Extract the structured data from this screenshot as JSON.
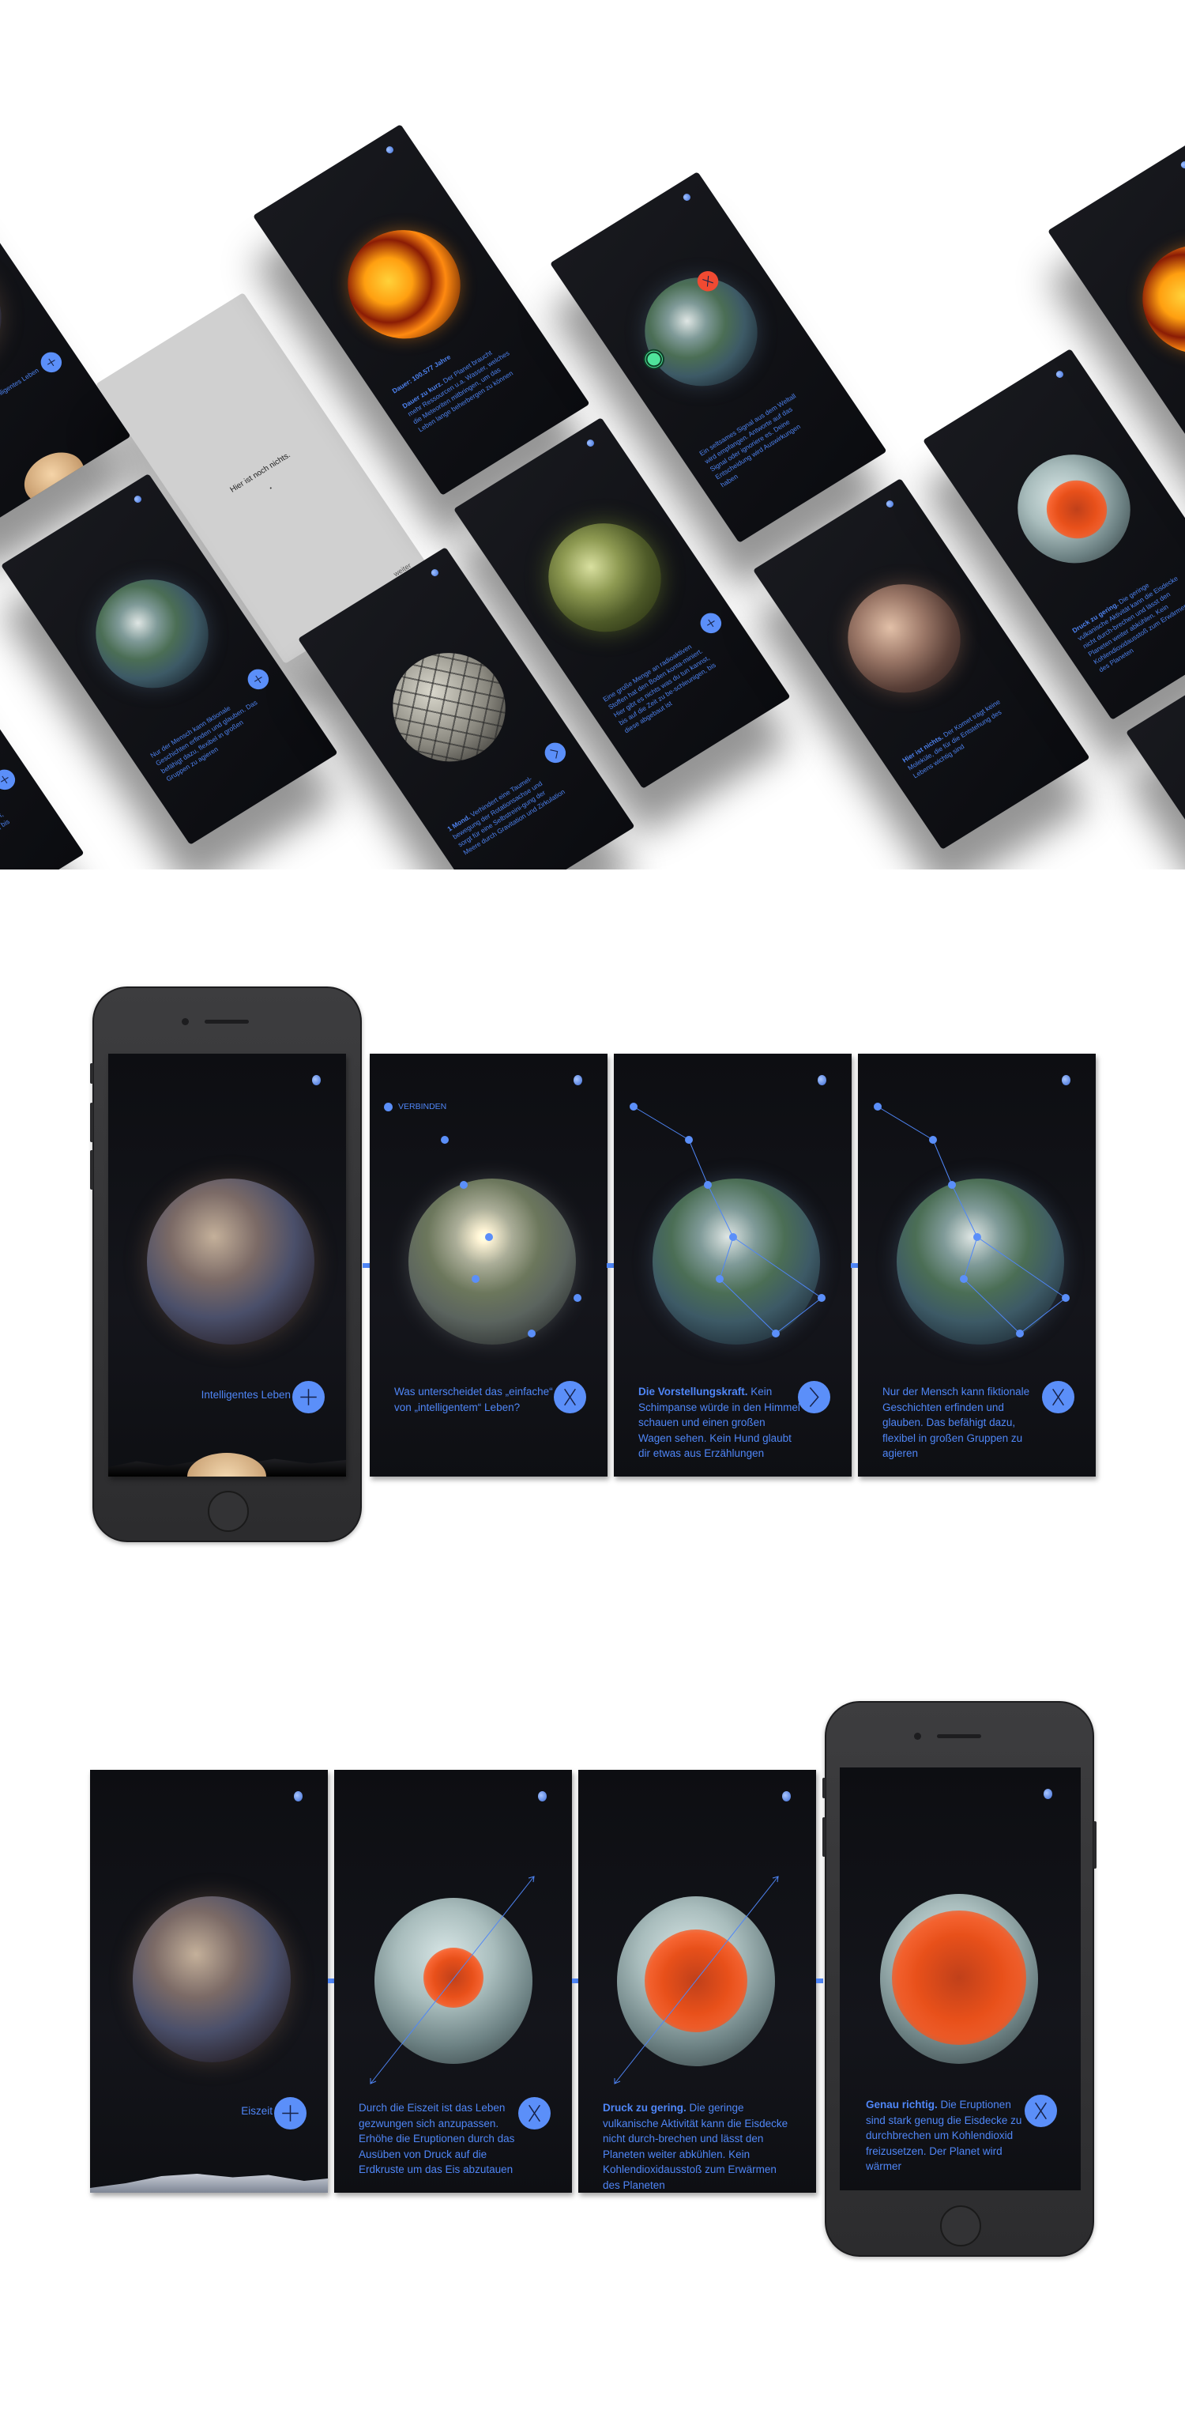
{
  "showcase_cards": [
    {
      "name": "intelligent-life-card",
      "planet": "rocky",
      "label": "Intelligentes Leben",
      "button": "plus-icon"
    },
    {
      "name": "empty-card",
      "planet": "none",
      "title": "Hier ist noch nichts.",
      "next_label": "weiter"
    },
    {
      "name": "duration-card",
      "planet": "lava",
      "subtitle": "Dauer: 100.577 Jahre",
      "bold": "Dauer zu kurz.",
      "text": " Der Planet braucht mehr Ressourcen u.a. Wasser, welches die Meteoriten mitbringen, um das Leben lange beherbergen zu können"
    },
    {
      "name": "signal-card",
      "planet": "earth",
      "text": "Ein seltsames Signal aus dem Weltall wird empfangen. Antworte auf das Signal oder ignoriere es. Deine Entscheidung wird Auswirkungen haben",
      "answer": "signal-icon",
      "ignore": "close-icon"
    },
    {
      "name": "radioactive-card",
      "planet": "toxic",
      "text": "Eine große Menge an radioaktiven Stoffen hat den Boden konta-miniert. Hier gibt es nichts was du tun kannst, bis auf die Zeit zu be-schleunigen, bis diese abgebaut ist",
      "button": "plus-icon"
    },
    {
      "name": "comet-card",
      "planet": "comet",
      "bold": "Hier ist nichts.",
      "text": " Der Komet trägt keine Moleküle, die für die Entstehung des Lebens wichtig sind"
    },
    {
      "name": "ice-pressure-card",
      "planet": "ice",
      "bold": "Druck zu gering.",
      "text": " Die geringe vulkanische Aktivität kann die Eisdecke nicht durch-brechen und lässt den Planeten weiter abkühlen. Kein Kohlendioxidausstoß zum Erwärmen des Planeten"
    },
    {
      "name": "lava-card-right",
      "planet": "lava"
    },
    {
      "name": "imagination-card",
      "planet": "earth",
      "text": "Nur der Mensch kann fiktionale Geschichten erfinden und glauben. Das befähigt dazu, flexibel in großen Gruppen zu agieren",
      "button": "plus-icon"
    },
    {
      "name": "moon-card",
      "planet": "poly",
      "bold": "1 Mond.",
      "text": " Verhindert eine Taumel-bewegung der Rotationsachse und sorgt für eine Selbstreini-gung der Meere durch Gravitation und Zirkulation",
      "button": "next-icon"
    },
    {
      "name": "radioactive-card-left",
      "planet": "toxic",
      "text": "Eine große Menge an radioaktiven Stoffen hat den Boden konta-miniert. Hier gibt es nichts was du tun kannst, bis auf die Zeit zu be-schleunigen, bis diese abgebaut ist",
      "button": "plus-icon"
    },
    {
      "name": "polyhedron-card-right",
      "planet": "poly"
    }
  ],
  "flow_intelligence": {
    "screens": [
      {
        "label": "Intelligentes Leben",
        "button": "plus-icon"
      },
      {
        "tag": "VERBINDEN",
        "text": "Was unterscheidet das „einfache“ von „intelligentem“ Leben?",
        "button": "close-icon"
      },
      {
        "bold": "Die Vorstellungskraft.",
        "text": " Kein Schimpanse würde in den Himmel schauen und einen großen Wagen sehen. Kein Hund glaubt dir etwas aus Erzählungen",
        "button": "next-icon"
      },
      {
        "text": "Nur der Mensch kann fiktionale Geschichten erfinden und glauben. Das befähigt dazu, flexibel in großen Gruppen zu agieren",
        "button": "close-icon"
      }
    ]
  },
  "flow_iceage": {
    "screens": [
      {
        "label": "Eiszeit",
        "button": "plus-icon"
      },
      {
        "text": "Durch die Eiszeit ist das Leben gezwungen sich anzupassen. Erhöhe die Eruptionen durch das Ausüben von Druck auf die Erdkruste um das Eis abzutauen",
        "button": "close-icon"
      },
      {
        "bold": "Druck zu gering.",
        "text": " Die geringe vulkanische Aktivität kann die Eisdecke nicht durch-brechen und lässt den Planeten weiter abkühlen. Kein Kohlendioxidausstoß zum Erwärmen des Planeten"
      },
      {
        "bold": "Genau richtig.",
        "text": " Die Eruptionen sind stark genug die Eisdecke zu durchbrechen um Kohlendioxid freizusetzen. Der Planet wird wärmer",
        "button": "close-icon"
      }
    ]
  },
  "colors": {
    "accent": "#5b8ff9",
    "text_blue": "#4f86f7",
    "screen_bg": "#0d0e12",
    "eruption": "#e8501a",
    "signal_green": "#4fe39b",
    "signal_red": "#f04a32"
  }
}
